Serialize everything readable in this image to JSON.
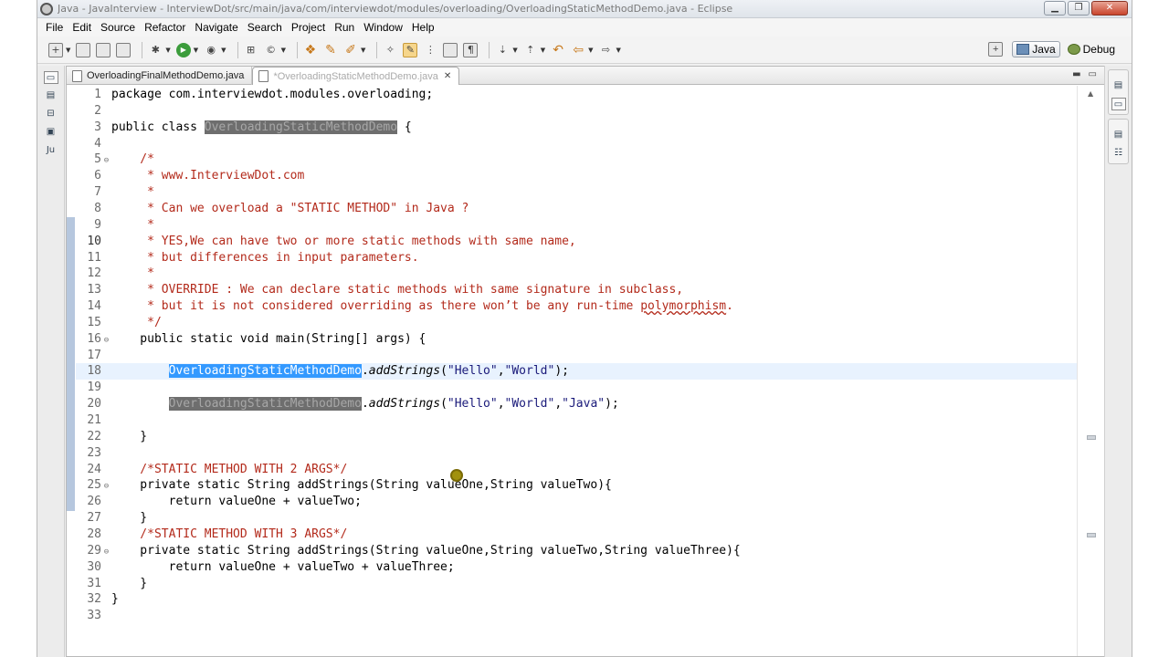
{
  "window": {
    "title": "Java - JavaInterview - InterviewDot/src/main/java/com/interviewdot/modules/overloading/OverloadingStaticMethodDemo.java - Eclipse"
  },
  "menu": [
    "File",
    "Edit",
    "Source",
    "Refactor",
    "Navigate",
    "Search",
    "Project",
    "Run",
    "Window",
    "Help"
  ],
  "perspectives": {
    "java": "Java",
    "debug": "Debug"
  },
  "tabs": [
    {
      "label": "OverloadingFinalMethodDemo.java",
      "active": false
    },
    {
      "label": "*OverloadingStaticMethodDemo.java",
      "active": true
    }
  ],
  "code_lines": [
    {
      "n": "1",
      "fold": "",
      "segs": [
        {
          "t": "package com.interviewdot.modules.overloading;",
          "c": "code"
        }
      ]
    },
    {
      "n": "2",
      "fold": "",
      "segs": []
    },
    {
      "n": "3",
      "fold": "",
      "segs": [
        {
          "t": "public class ",
          "c": "kw"
        },
        {
          "t": "OverloadingStaticMethodDemo",
          "c": "hl-dark"
        },
        {
          "t": " {",
          "c": "code"
        }
      ]
    },
    {
      "n": "4",
      "fold": "",
      "segs": []
    },
    {
      "n": "5",
      "fold": "⊖",
      "segs": [
        {
          "t": "    /*",
          "c": "cm"
        }
      ]
    },
    {
      "n": "6",
      "fold": "",
      "segs": [
        {
          "t": "     * www.InterviewDot.com",
          "c": "cm"
        }
      ]
    },
    {
      "n": "7",
      "fold": "",
      "segs": [
        {
          "t": "     *",
          "c": "cm"
        }
      ]
    },
    {
      "n": "8",
      "fold": "",
      "segs": [
        {
          "t": "     * Can we overload a \"STATIC METHOD\" in Java ?",
          "c": "cm"
        }
      ]
    },
    {
      "n": "9",
      "fold": "",
      "segs": [
        {
          "t": "     *",
          "c": "cm"
        }
      ]
    },
    {
      "n": "10",
      "fold": "",
      "segs": [
        {
          "t": "     * YES,We can have two or more static methods with same name,",
          "c": "cm"
        }
      ]
    },
    {
      "n": "11",
      "fold": "",
      "segs": [
        {
          "t": "     * but differences in input parameters.",
          "c": "cm"
        }
      ]
    },
    {
      "n": "12",
      "fold": "",
      "segs": [
        {
          "t": "     *",
          "c": "cm"
        }
      ]
    },
    {
      "n": "13",
      "fold": "",
      "segs": [
        {
          "t": "     * OVERRIDE : We can declare static methods with same signature in subclass,",
          "c": "cm"
        }
      ]
    },
    {
      "n": "14",
      "fold": "",
      "segs": [
        {
          "t": "     * but it is not considered overriding as there won’t be any run-time ",
          "c": "cm"
        },
        {
          "t": "polymorphism",
          "c": "cm squiggle"
        },
        {
          "t": ".",
          "c": "cm"
        }
      ]
    },
    {
      "n": "15",
      "fold": "",
      "segs": [
        {
          "t": "     */",
          "c": "cm"
        }
      ]
    },
    {
      "n": "16",
      "fold": "⊖",
      "segs": [
        {
          "t": "    public static void main(String[] args) {",
          "c": "code"
        }
      ]
    },
    {
      "n": "17",
      "fold": "",
      "segs": []
    },
    {
      "n": "18",
      "fold": "",
      "segs": [
        {
          "t": "        ",
          "c": "code"
        },
        {
          "t": "OverloadingStaticMethodDemo",
          "c": "hl-sel"
        },
        {
          "t": ".",
          "c": "code"
        },
        {
          "t": "addStrings",
          "c": "it"
        },
        {
          "t": "(",
          "c": "code"
        },
        {
          "t": "\"Hello\"",
          "c": "str"
        },
        {
          "t": ",",
          "c": "code"
        },
        {
          "t": "\"World\"",
          "c": "str"
        },
        {
          "t": ");",
          "c": "code"
        }
      ]
    },
    {
      "n": "19",
      "fold": "",
      "segs": []
    },
    {
      "n": "20",
      "fold": "",
      "segs": [
        {
          "t": "        ",
          "c": "code"
        },
        {
          "t": "OverloadingStaticMethodDemo",
          "c": "hl-dark"
        },
        {
          "t": ".",
          "c": "code"
        },
        {
          "t": "addStrings",
          "c": "it"
        },
        {
          "t": "(",
          "c": "code"
        },
        {
          "t": "\"Hello\"",
          "c": "str"
        },
        {
          "t": ",",
          "c": "code"
        },
        {
          "t": "\"World\"",
          "c": "str"
        },
        {
          "t": ",",
          "c": "code"
        },
        {
          "t": "\"Java\"",
          "c": "str"
        },
        {
          "t": ");",
          "c": "code"
        }
      ]
    },
    {
      "n": "21",
      "fold": "",
      "segs": []
    },
    {
      "n": "22",
      "fold": "",
      "segs": [
        {
          "t": "    }",
          "c": "code"
        }
      ]
    },
    {
      "n": "23",
      "fold": "",
      "segs": []
    },
    {
      "n": "24",
      "fold": "",
      "segs": [
        {
          "t": "    /*STATIC METHOD WITH 2 ARGS*/",
          "c": "cm"
        }
      ]
    },
    {
      "n": "25",
      "fold": "⊖",
      "segs": [
        {
          "t": "    private static String addStrings(String valueOne,String valueTwo){",
          "c": "code"
        }
      ]
    },
    {
      "n": "26",
      "fold": "",
      "segs": [
        {
          "t": "        return valueOne + valueTwo;",
          "c": "code"
        }
      ]
    },
    {
      "n": "27",
      "fold": "",
      "segs": [
        {
          "t": "    }",
          "c": "code"
        }
      ]
    },
    {
      "n": "28",
      "fold": "",
      "segs": [
        {
          "t": "    /*STATIC METHOD WITH 3 ARGS*/",
          "c": "cm"
        }
      ]
    },
    {
      "n": "29",
      "fold": "⊖",
      "segs": [
        {
          "t": "    private static String addStrings(String valueOne,String valueTwo,String valueThree){",
          "c": "code"
        }
      ]
    },
    {
      "n": "30",
      "fold": "",
      "segs": [
        {
          "t": "        return valueOne + valueTwo + valueThree;",
          "c": "code"
        }
      ]
    },
    {
      "n": "31",
      "fold": "",
      "segs": [
        {
          "t": "    }",
          "c": "code"
        }
      ]
    },
    {
      "n": "32",
      "fold": "",
      "segs": [
        {
          "t": "}",
          "c": "code"
        }
      ]
    },
    {
      "n": "33",
      "fold": "",
      "segs": []
    }
  ],
  "current_line": "18",
  "caret_line": "10"
}
